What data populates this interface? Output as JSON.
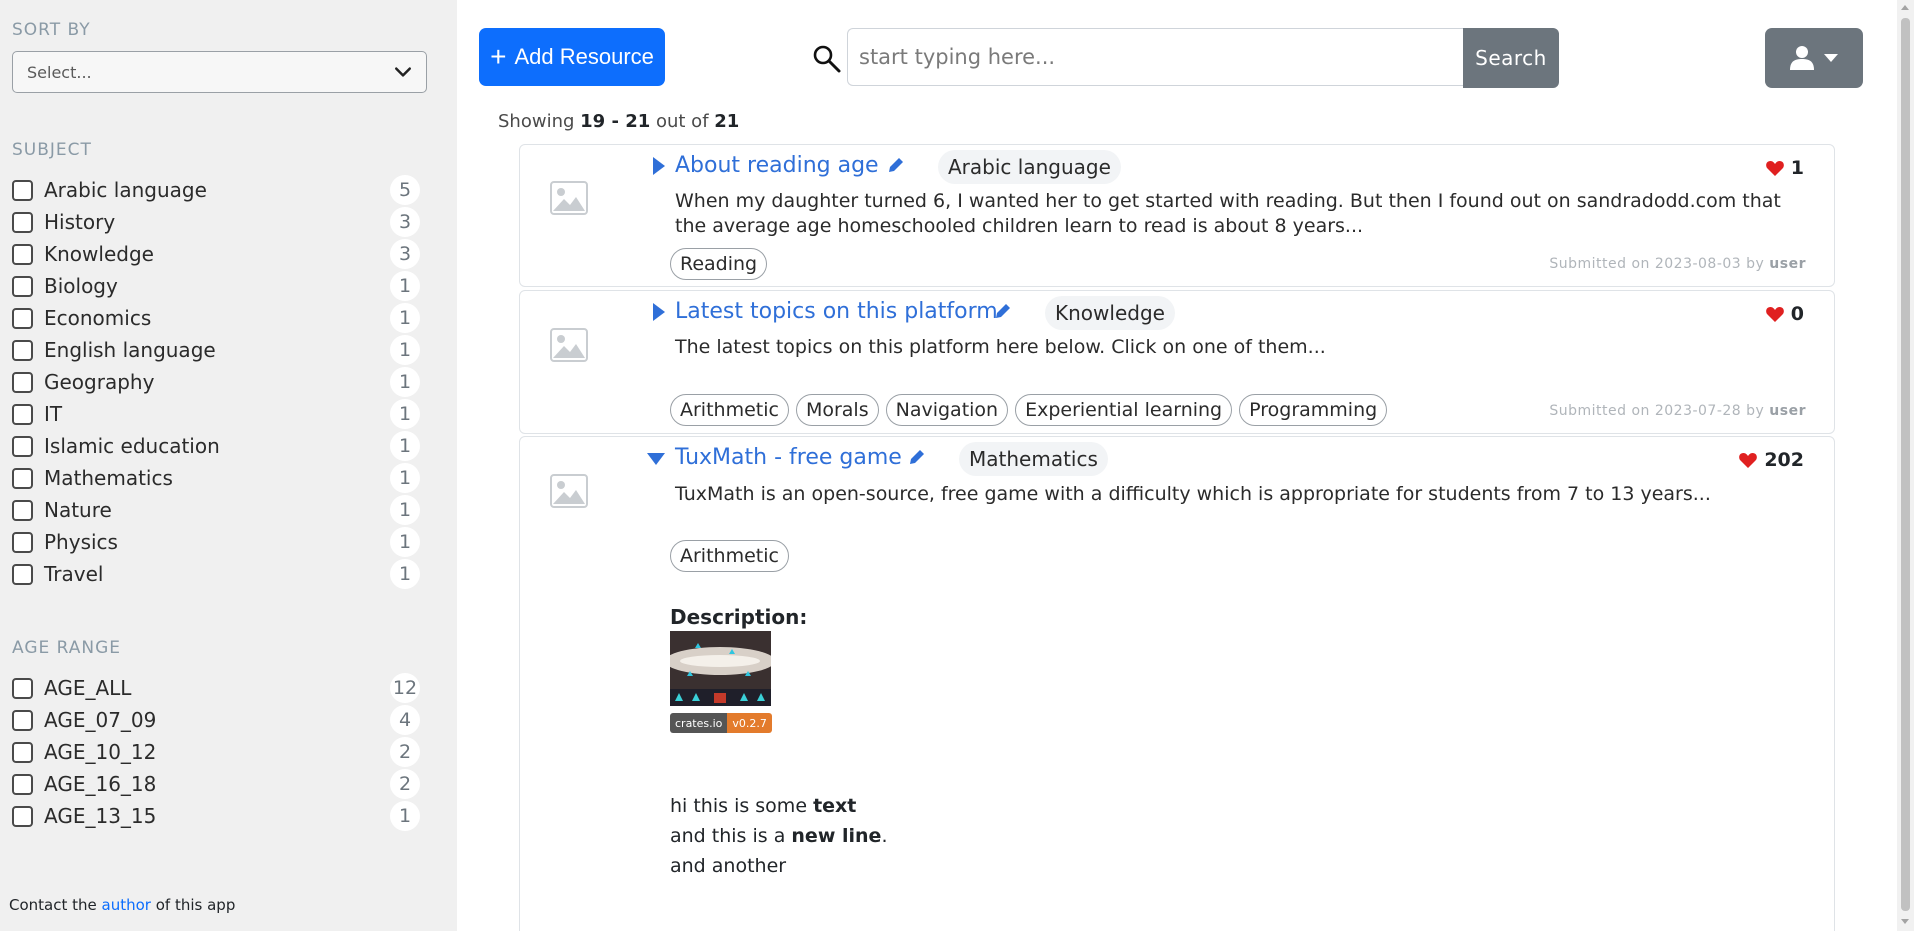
{
  "sidebar": {
    "sort_title": "SORT BY",
    "sort_placeholder": "Select...",
    "subject_title": "SUBJECT",
    "subjects": [
      {
        "label": "Arabic language",
        "count": "5"
      },
      {
        "label": "History",
        "count": "3"
      },
      {
        "label": "Knowledge",
        "count": "3"
      },
      {
        "label": "Biology",
        "count": "1"
      },
      {
        "label": "Economics",
        "count": "1"
      },
      {
        "label": "English language",
        "count": "1"
      },
      {
        "label": "Geography",
        "count": "1"
      },
      {
        "label": "IT",
        "count": "1"
      },
      {
        "label": "Islamic education",
        "count": "1"
      },
      {
        "label": "Mathematics",
        "count": "1"
      },
      {
        "label": "Nature",
        "count": "1"
      },
      {
        "label": "Physics",
        "count": "1"
      },
      {
        "label": "Travel",
        "count": "1"
      }
    ],
    "age_title": "AGE RANGE",
    "ages": [
      {
        "label": "AGE_ALL",
        "count": "12"
      },
      {
        "label": "AGE_07_09",
        "count": "4"
      },
      {
        "label": "AGE_10_12",
        "count": "2"
      },
      {
        "label": "AGE_16_18",
        "count": "2"
      },
      {
        "label": "AGE_13_15",
        "count": "1"
      }
    ],
    "contact_pre": "Contact the",
    "contact_link": "author",
    "contact_post": "of this app"
  },
  "header": {
    "add_label": "Add Resource",
    "search_placeholder": "start typing here...",
    "search_value": "",
    "search_label": "Search"
  },
  "results": {
    "showing_pre": "Showing",
    "range": "19 - 21",
    "out_of": "out of",
    "total": "21"
  },
  "cards": [
    {
      "title": "About reading age",
      "subject": "Arabic language",
      "likes": "1",
      "summary": "When my daughter turned 6, I wanted her to get started with reading. But then I found out on sandradodd.com that the average age homeschooled children learn to read is about 8 years...",
      "tags": [
        "Reading"
      ],
      "submitted_pre": "Submitted on",
      "date": "2023-08-03",
      "by": "by",
      "user": "user"
    },
    {
      "title": "Latest topics on this platform",
      "subject": "Knowledge",
      "likes": "0",
      "summary": "The latest topics on this platform here below. Click on one of them...",
      "tags": [
        "Arithmetic",
        "Morals",
        "Navigation",
        "Experiential learning",
        "Programming"
      ],
      "submitted_pre": "Submitted on",
      "date": "2023-07-28",
      "by": "by",
      "user": "user"
    },
    {
      "title": "TuxMath - free game",
      "subject": "Mathematics",
      "likes": "202",
      "summary": "TuxMath is an open-source, free game with a difficulty which is appropriate for students from 7 to 13 years...",
      "tags": [
        "Arithmetic"
      ],
      "description_heading": "Description:",
      "badge_left": "crates.io",
      "badge_right": "v0.2.7",
      "line1_pre": "hi this is some",
      "line1_bold": "text",
      "line2_pre": "and this is a",
      "line2_bold": "new line",
      "line2_post": ".",
      "line3": "and another"
    }
  ],
  "colors": {
    "primary": "#0d6efd",
    "secondary": "#6c757d",
    "link": "#2f6fd8",
    "heart": "#e02020"
  }
}
